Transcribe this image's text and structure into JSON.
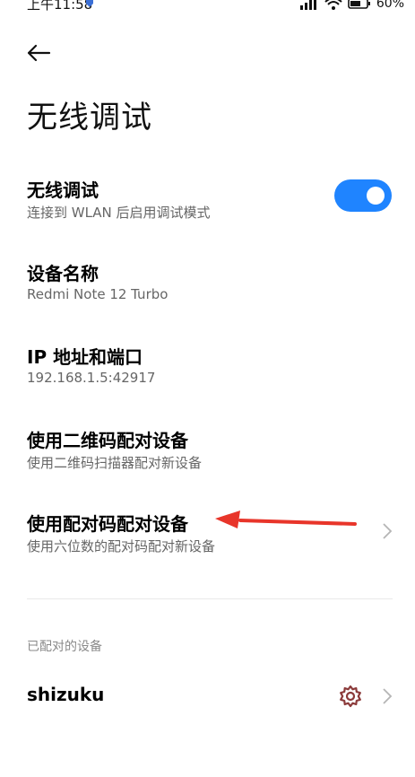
{
  "status_bar": {
    "time": "上午11:58",
    "battery": "60%",
    "icons": [
      "app-notification-icon",
      "signal-icon",
      "wifi-icon",
      "battery-icon"
    ]
  },
  "header": {
    "back_icon": "back-arrow-icon",
    "title": "无线调试"
  },
  "settings": [
    {
      "title": "无线调试",
      "subtitle": "连接到 WLAN 后启用调试模式",
      "control": "toggle",
      "toggle_on": true
    },
    {
      "title": "设备名称",
      "subtitle": "Redmi Note 12 Turbo"
    },
    {
      "title": "IP 地址和端口",
      "subtitle": "192.168.1.5:42917"
    },
    {
      "title": "使用二维码配对设备",
      "subtitle": "使用二维码扫描器配对新设备"
    },
    {
      "title": "使用配对码配对设备",
      "subtitle": "使用六位数的配对码配对新设备",
      "control": "chevron"
    }
  ],
  "paired_section": {
    "label": "已配对的设备",
    "devices": [
      {
        "name": "shizuku",
        "actions": [
          "gear-icon",
          "chevron-right-icon"
        ]
      }
    ]
  },
  "colors": {
    "accent": "#1f84ff",
    "annotation_arrow": "#e8352a",
    "gear": "#8b3a3a",
    "subtitle": "#666666",
    "section_label": "#8a8a8a"
  }
}
